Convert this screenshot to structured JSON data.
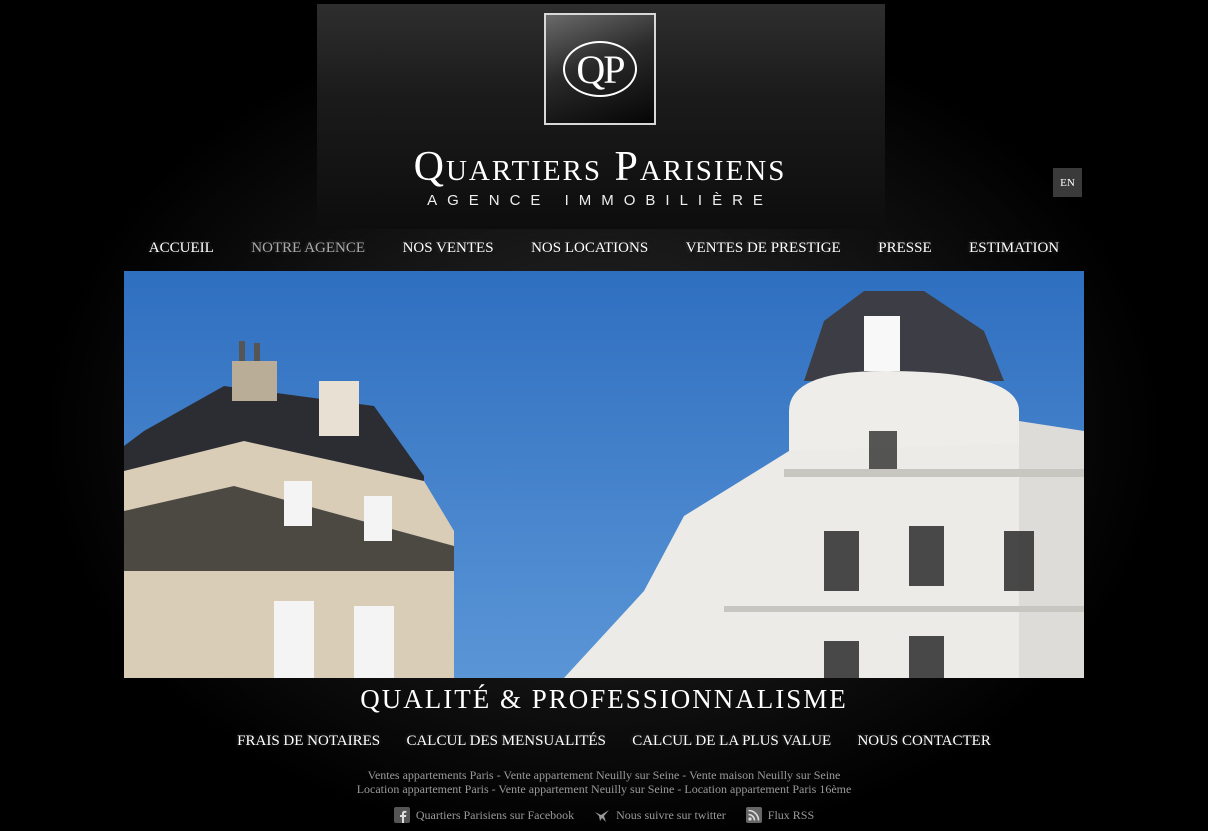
{
  "header": {
    "logo_monogram": "QP",
    "brand_name": "Quartiers Parisiens",
    "brand_tagline": "AGENCE IMMOBILIÈRE",
    "lang_button": "EN"
  },
  "main_nav": {
    "items": [
      {
        "label": "ACCUEIL",
        "active": false
      },
      {
        "label": "NOTRE AGENCE",
        "active": true
      },
      {
        "label": "NOS VENTES",
        "active": false
      },
      {
        "label": "NOS LOCATIONS",
        "active": false
      },
      {
        "label": "VENTES DE PRESTIGE",
        "active": false
      },
      {
        "label": "PRESSE",
        "active": false
      },
      {
        "label": "ESTIMATION",
        "active": false
      }
    ]
  },
  "hero": {
    "slogan": "QUALITÉ  &  PROFESSIONNALISME"
  },
  "sub_nav": {
    "items": [
      {
        "label": "FRAIS DE NOTAIRES"
      },
      {
        "label": "CALCUL DES MENSUALITÉS"
      },
      {
        "label": "CALCUL DE LA PLUS VALUE"
      },
      {
        "label": "NOUS CONTACTER"
      }
    ]
  },
  "footer": {
    "seo_line_1": "Ventes appartements Paris - Vente appartement Neuilly sur Seine - Vente maison Neuilly sur Seine",
    "seo_line_2": "Location appartement Paris - Vente appartement Neuilly sur Seine - Location appartement Paris 16ème",
    "social": [
      {
        "icon": "facebook-icon",
        "label": "Quartiers Parisiens sur Facebook"
      },
      {
        "icon": "twitter-bird-icon",
        "label": "Nous suivre sur twitter"
      },
      {
        "icon": "rss-icon",
        "label": "Flux RSS"
      }
    ]
  },
  "colors": {
    "background": "#000000",
    "nav_text": "#ffffff",
    "nav_active": "#aaaaaa",
    "footer_text": "#9a9a9a",
    "sky": "#3f7cc4"
  }
}
